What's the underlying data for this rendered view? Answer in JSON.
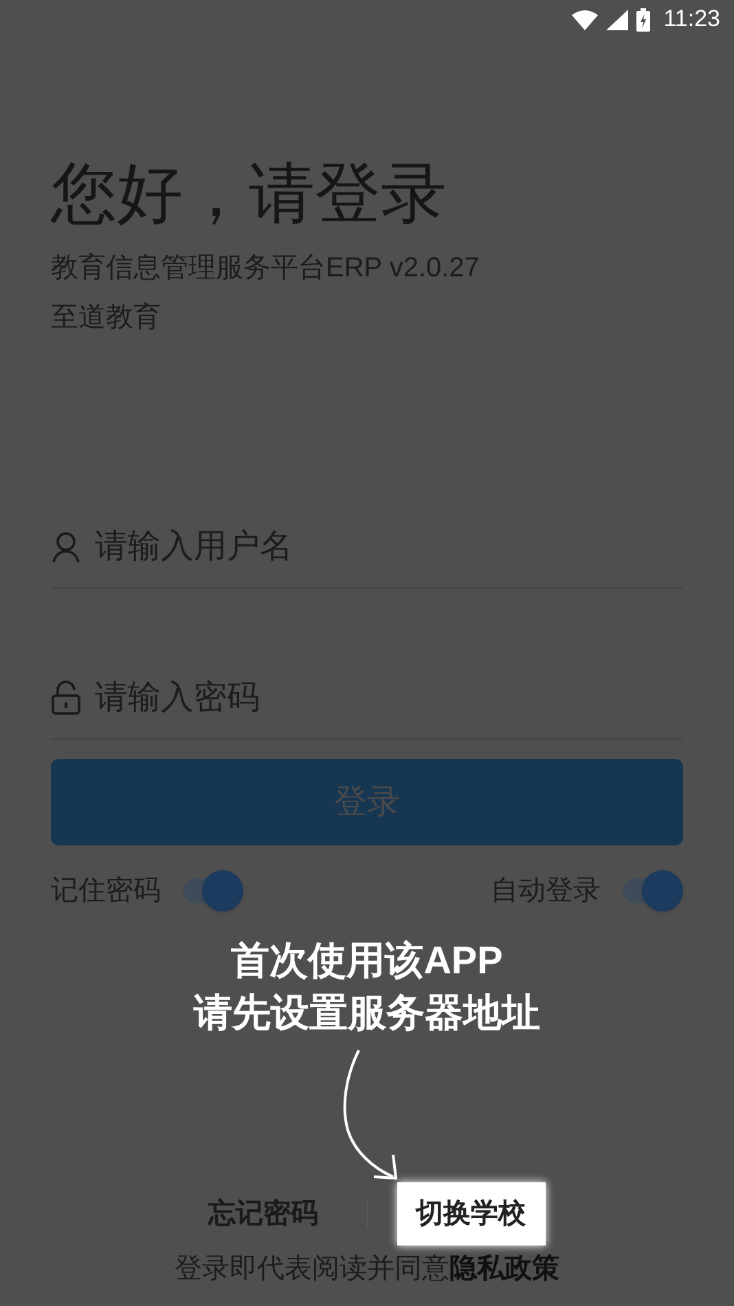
{
  "status_bar": {
    "time": "11:23"
  },
  "heading": "您好，请登录",
  "subtitle": "教育信息管理服务平台ERP v2.0.27",
  "organization": "至道教育",
  "fields": [
    {
      "kind": "user",
      "placeholder": "请输入用户名"
    },
    {
      "kind": "password",
      "placeholder": "请输入密码"
    }
  ],
  "login_button": "登录",
  "switches": [
    {
      "label": "记住密码",
      "on": true
    },
    {
      "label": "自动登录",
      "on": true
    }
  ],
  "guide": {
    "lines": [
      "首次使用该APP",
      "请先设置服务器地址"
    ]
  },
  "links": [
    {
      "label": "忘记密码",
      "highlighted": false
    },
    {
      "label": "切换学校",
      "highlighted": true
    }
  ],
  "agreement": {
    "text": "登录即代表阅读并同意",
    "link": "隐私政策"
  }
}
